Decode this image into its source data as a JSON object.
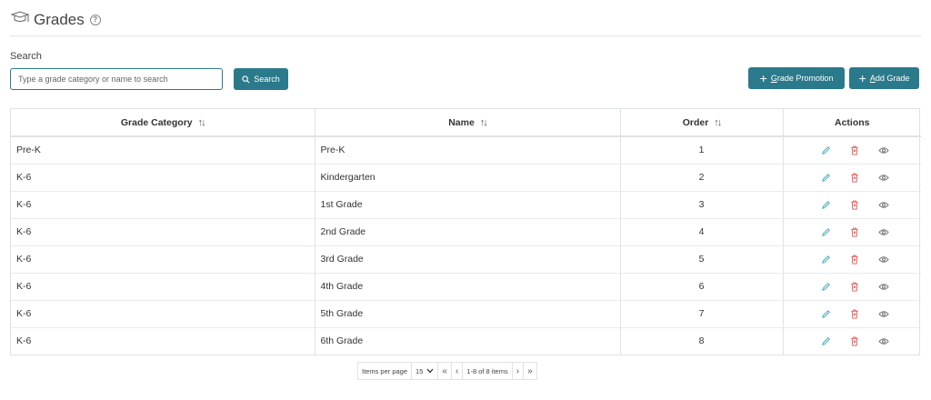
{
  "page": {
    "title": "Grades",
    "help_symbol": "?"
  },
  "search": {
    "label": "Search",
    "placeholder": "Type a grade category or name to search",
    "button_label": "Search"
  },
  "toolbar": {
    "grade_promotion_first": "G",
    "grade_promotion_rest": "rade Promotion",
    "add_grade_first": "A",
    "add_grade_rest": "dd Grade"
  },
  "table": {
    "columns": [
      "Grade Category",
      "Name",
      "Order",
      "Actions"
    ],
    "rows": [
      {
        "category": "Pre-K",
        "name": "Pre-K",
        "order": "1"
      },
      {
        "category": "K-6",
        "name": "Kindergarten",
        "order": "2"
      },
      {
        "category": "K-6",
        "name": "1st Grade",
        "order": "3"
      },
      {
        "category": "K-6",
        "name": "2nd Grade",
        "order": "4"
      },
      {
        "category": "K-6",
        "name": "3rd Grade",
        "order": "5"
      },
      {
        "category": "K-6",
        "name": "4th Grade",
        "order": "6"
      },
      {
        "category": "K-6",
        "name": "5th Grade",
        "order": "7"
      },
      {
        "category": "K-6",
        "name": "6th Grade",
        "order": "8"
      }
    ]
  },
  "pagination": {
    "items_per_page_label": "Items per page",
    "items_per_page_value": "15",
    "range_text": "1-8 of 8 items"
  },
  "colors": {
    "accent": "#2b7a8c",
    "edit": "#3aa6b9",
    "delete": "#e05555",
    "view": "#777777"
  },
  "icons": [
    "graduation-cap-icon",
    "help-icon",
    "search-icon",
    "plus-icon",
    "sort-icon",
    "edit-icon",
    "delete-icon",
    "view-icon",
    "chevron-down-icon",
    "first-page-icon",
    "prev-page-icon",
    "next-page-icon",
    "last-page-icon"
  ]
}
